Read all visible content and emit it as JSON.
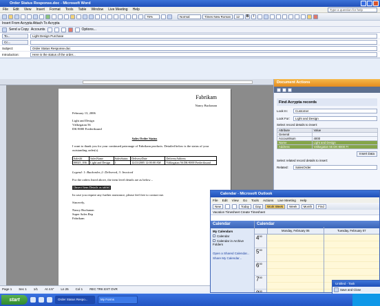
{
  "word": {
    "title": "Order Status Response.doc - Microsoft Word",
    "menus": [
      "File",
      "Edit",
      "View",
      "Insert",
      "Format",
      "Tools",
      "Table",
      "Window",
      "Live Meeting",
      "Help"
    ],
    "help_placeholder": "Type a question for help",
    "zoom": "75%",
    "style": "Normal",
    "font": "Times New Roman",
    "font_size": "12",
    "insert_bar": "Insert From Acrypta  Attach To Acrypta",
    "send_bar": {
      "send": "Send a Copy",
      "accounts": "Accounts",
      "options": "Options..."
    },
    "envelope": {
      "to_label": "To...",
      "to_value": "Light Design Purchase",
      "cc_label": "Cc...",
      "cc_value": "",
      "subject_label": "Subject:",
      "subject_value": "Order Status Response.doc",
      "intro_label": "Introduction:",
      "intro_value": "Here is the status of the order..."
    },
    "status_bar": {
      "page": "Page 1",
      "sec": "Sec 1",
      "pos": "1/1",
      "at": "At 4.5\"",
      "ln": "Ln 25",
      "col": "Col 1",
      "flags": "REC  TRK  EXT  OVR"
    }
  },
  "letter": {
    "brand": "Fabrikam",
    "sender": "Nancy Buchanan",
    "date": "February 13, 2006",
    "recipient": [
      "Light and Design",
      "Välkegatan 56",
      "DK-8000  Frederiksund"
    ],
    "heading": "Sales Order Status",
    "body": "I want to thank you for your continued patronage of Fabrikam products. Detailed below is the status of your outstanding order(s).",
    "table_headers": [
      "SalesId",
      "SalesName",
      "SalesStatus",
      "DeliveryDate",
      "DeliveryAddress"
    ],
    "table_row": [
      "00025_036",
      "Light and Design",
      "1",
      "12/23/2005 12:00:00 AM",
      "Välkegatan 56 DK-8000 Frederiksund"
    ],
    "legend": "Legend: 1: Backorder, 2: Delivered, 3: Invoiced",
    "items_intro": "For the orders listed above, the item level details are as below –",
    "insert_item": "[Insert Item Details as table]",
    "closing": "In case you require any further assistance, please feel free to contact me.",
    "sincerely": "Sincerely,",
    "signature": [
      "Nancy Buchanan",
      "Super Sales Rep",
      "Fabrikam"
    ]
  },
  "actions": {
    "header": "Document Actions",
    "find_title": "Find Acrypta records",
    "look_in_label": "Look In:",
    "look_in_value": "Customer",
    "look_for_label": "Look For:",
    "look_for_value": "Light and Design",
    "select_note": "Select record details to insert:",
    "table_headers": [
      "Attribute",
      "Value"
    ],
    "rows": [
      {
        "attr": "General",
        "value": ""
      },
      {
        "attr": "AccountNum",
        "value": "4000"
      },
      {
        "attr": "Name",
        "value": "Light and Design"
      },
      {
        "attr": "Address",
        "value": "Välkegatan 56 DK-8000 Fr"
      }
    ],
    "insert_button": "Insert Data",
    "related_note": "Select related record details to insert:",
    "related_label": "Related:",
    "related_value": "SalesOrder"
  },
  "outlook": {
    "title": "Calendar - Microsoft Outlook",
    "menus": [
      "File",
      "Edit",
      "View",
      "Go",
      "Tools",
      "Actions",
      "Live Meeting",
      "Help"
    ],
    "toolbar": [
      "New",
      "Today",
      "Day",
      "Work Week",
      "Week",
      "Month",
      "Find"
    ],
    "active_view": "Work Week",
    "subbar": "Vacation  Timesheet  Create Timesheet",
    "nav_header": "Calendar",
    "my_calendars": "My Calendars",
    "cal_items": [
      "Calendar",
      "Calendar in Archive Folders"
    ],
    "links": [
      "Open a Shared Calendar...",
      "Share My Calendar..."
    ],
    "cal_header": "Calendar",
    "days": [
      "Monday, February 06",
      "Tuesday, February 07"
    ],
    "hours": [
      "4",
      "5",
      "6",
      "7",
      "8"
    ],
    "hour_suffix": "00"
  },
  "msg": {
    "title": "Untitled - Task",
    "save": "Save and Close",
    "status_label": "Status:",
    "status_value": "Open"
  },
  "taskbar": {
    "start": "start",
    "tasks": [
      "Order Status Respo...",
      "My Forms"
    ],
    "clock": ""
  }
}
